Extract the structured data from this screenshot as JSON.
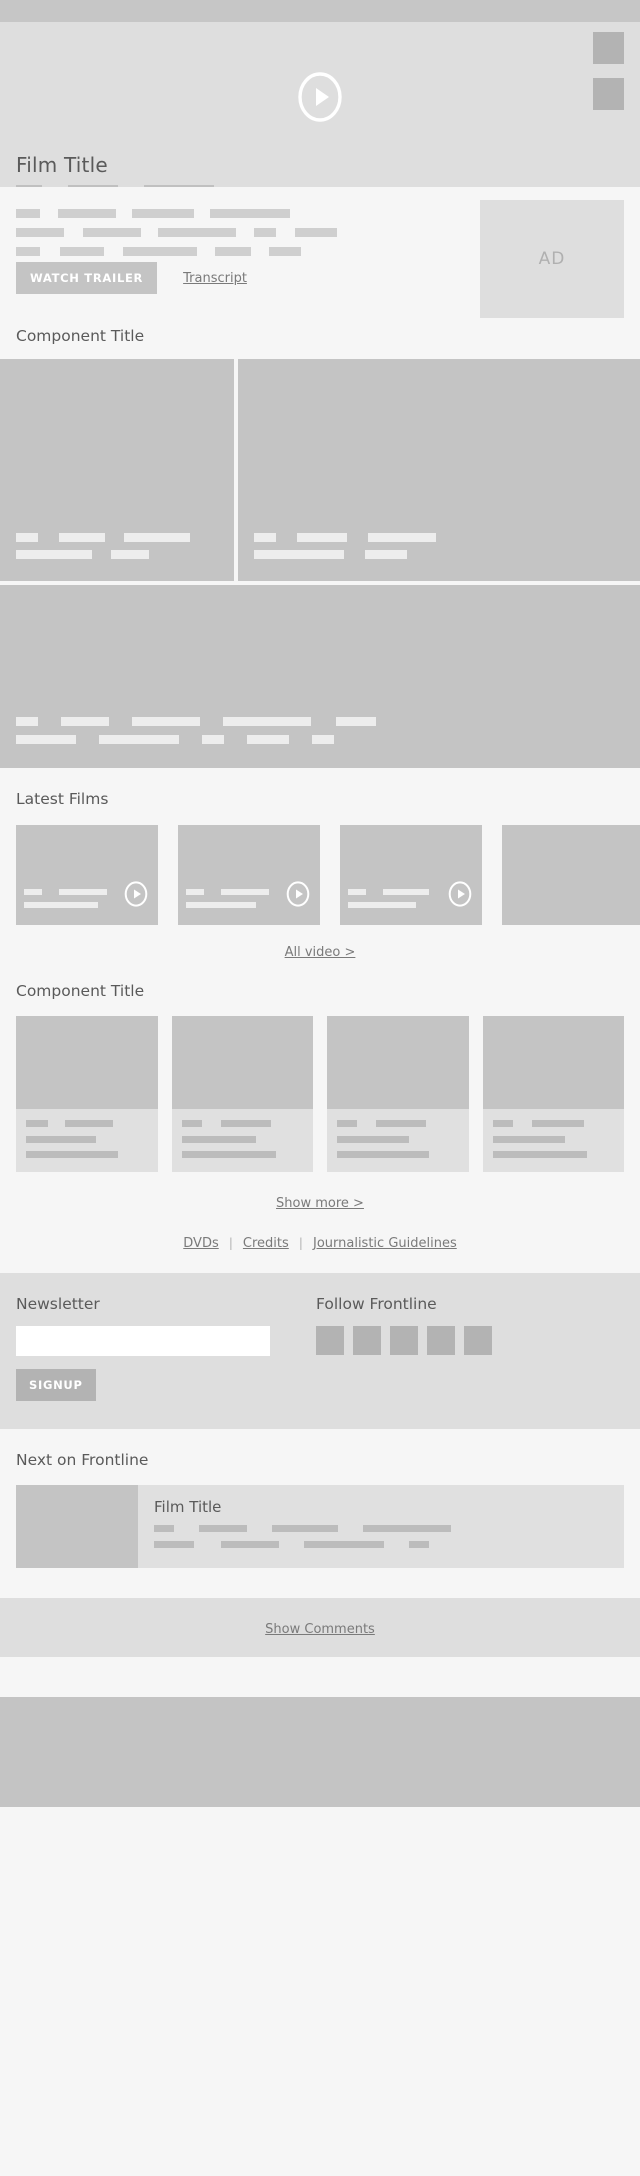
{
  "nav": {
    "label": ""
  },
  "hero": {
    "title": "Film Title",
    "play_icon": "play-circle-icon",
    "side_buttons": [
      "share-button",
      "bookmark-button"
    ],
    "meta_bars": [
      26,
      50,
      62
    ]
  },
  "intro": {
    "lines": [
      [
        24,
        58,
        62,
        80
      ],
      [
        42,
        58,
        78,
        22,
        42
      ],
      [
        24,
        42,
        74,
        36,
        32
      ]
    ],
    "watch_trailer_label": "WATCH TRAILER",
    "transcript_label": "Transcript",
    "ad_label": "AD"
  },
  "component_section_1": {
    "title": "Component Title",
    "card_left": {
      "lines": [
        [
          22,
          46,
          56
        ],
        [
          58,
          36
        ]
      ]
    },
    "card_right": {
      "lines": [
        [
          22,
          50,
          58
        ],
        [
          64,
          38
        ]
      ]
    },
    "card_wide": {
      "lines": [
        [
          22,
          48,
          68,
          88,
          40
        ],
        [
          60,
          80,
          22,
          42,
          22
        ]
      ]
    }
  },
  "latest_films": {
    "title": "Latest Films",
    "cards": [
      {
        "lines": [
          [
            18,
            48
          ],
          [
            74
          ]
        ]
      },
      {
        "lines": [
          [
            18,
            48
          ],
          [
            70
          ]
        ]
      },
      {
        "lines": [
          [
            18,
            46
          ],
          [
            68
          ]
        ]
      },
      {
        "lines": [
          [
            16,
            40
          ],
          [
            60
          ]
        ]
      }
    ],
    "all_video_label": "All video  >"
  },
  "component_section_2": {
    "title": "Component Title",
    "cards": [
      {
        "lines": [
          [
            22,
            48
          ],
          [
            58
          ],
          [
            74
          ]
        ]
      },
      {
        "lines": [
          [
            20,
            46
          ],
          [
            56
          ],
          [
            72
          ]
        ]
      },
      {
        "lines": [
          [
            20,
            46
          ],
          [
            56
          ],
          [
            70
          ]
        ]
      },
      {
        "lines": [
          [
            20,
            46
          ],
          [
            54
          ],
          [
            72
          ]
        ]
      }
    ],
    "show_more_label": "Show more >"
  },
  "footer_links": {
    "items": [
      "DVDs",
      "Credits",
      "Journalistic Guidelines"
    ],
    "separator": "|"
  },
  "newsletter": {
    "heading": "Newsletter",
    "email_value": "",
    "email_placeholder": "",
    "signup_label": "SIGNUP",
    "follow_heading": "Follow Frontline",
    "social_icons": [
      "facebook-icon",
      "twitter-icon",
      "youtube-icon",
      "instagram-icon",
      "rss-icon"
    ]
  },
  "next_on_frontline": {
    "heading": "Next on Frontline",
    "card_title": "Film Title",
    "lines": [
      [
        20,
        46,
        54,
        70
      ],
      [
        38,
        44,
        54,
        18
      ]
    ]
  },
  "comments": {
    "show_comments_label": "Show Comments"
  },
  "colors": {
    "page_bg": "#f6f6f6",
    "nav_bg": "#c6c6c6",
    "hero_bg": "#dedede",
    "card_bg": "#c4c4c4",
    "panel_bg": "#e0e0e0",
    "text": "#5a5a5a",
    "link": "#7a7a7a"
  }
}
